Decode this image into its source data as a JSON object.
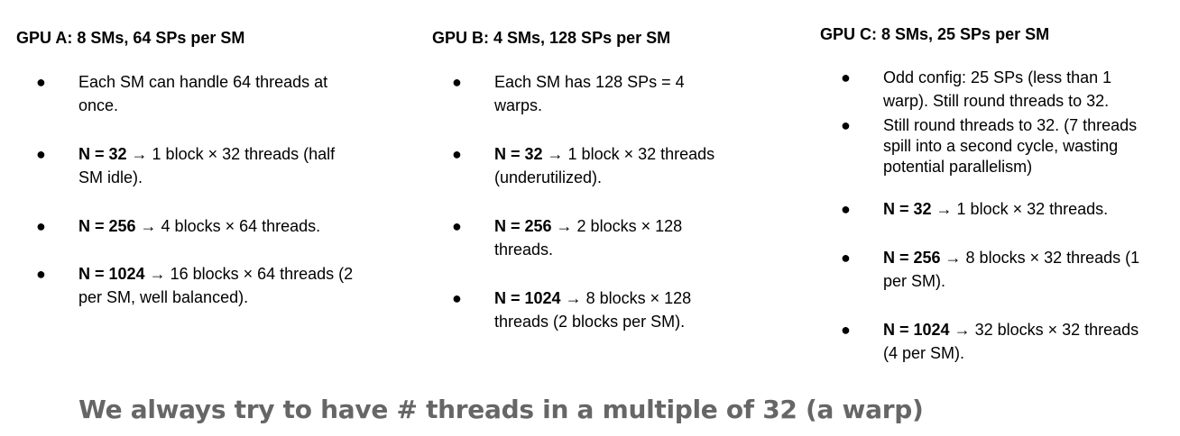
{
  "columns": [
    {
      "title": "GPU A: 8 SMs, 64 SPs per SM",
      "items": [
        {
          "lines": [
            "Each SM can handle 64 threads at",
            "once."
          ]
        },
        {
          "bold": "N = 32",
          "rest": " → 1 block × 32 threads (half",
          "line2": "SM idle)."
        },
        {
          "bold": "N = 256",
          "rest": " → 4 blocks × 64 threads."
        },
        {
          "bold": "N = 1024",
          "rest": " → 16 blocks × 64 threads (2",
          "line2": "per SM, well balanced)."
        }
      ]
    },
    {
      "title": "GPU B: 4 SMs, 128 SPs per SM",
      "items": [
        {
          "lines": [
            "Each SM has 128 SPs = 4",
            "warps."
          ]
        },
        {
          "bold": "N = 32",
          "rest": " → 1 block × 32 threads",
          "line2": "(underutilized)."
        },
        {
          "bold": "N = 256",
          "rest": " → 2 blocks × 128",
          "line2": "threads."
        },
        {
          "bold": "N = 1024",
          "rest": " → 8 blocks × 128",
          "line2": "threads (2 blocks per SM)."
        }
      ]
    },
    {
      "title": "GPU C: 8 SMs, 25 SPs per SM",
      "items": [
        {
          "lines": [
            "Odd config: 25 SPs (less than 1",
            "warp). Still round threads to 32."
          ]
        },
        {
          "lines": [
            "Still round threads to 32. (7 threads",
            "spill into a second cycle, wasting",
            "potential parallelism)"
          ]
        },
        {
          "bold": "N = 32",
          "rest": " → 1 block × 32 threads."
        },
        {
          "bold": "N = 256",
          "rest": " → 8 blocks × 32 threads (1",
          "line2": "per SM)."
        },
        {
          "bold": "N = 1024",
          "rest": " → 32 blocks × 32 threads",
          "line2": "(4 per SM)."
        }
      ]
    }
  ],
  "bullet_glyph": "●",
  "footer": "We always try to have # threads in a multiple of 32 (a warp)"
}
